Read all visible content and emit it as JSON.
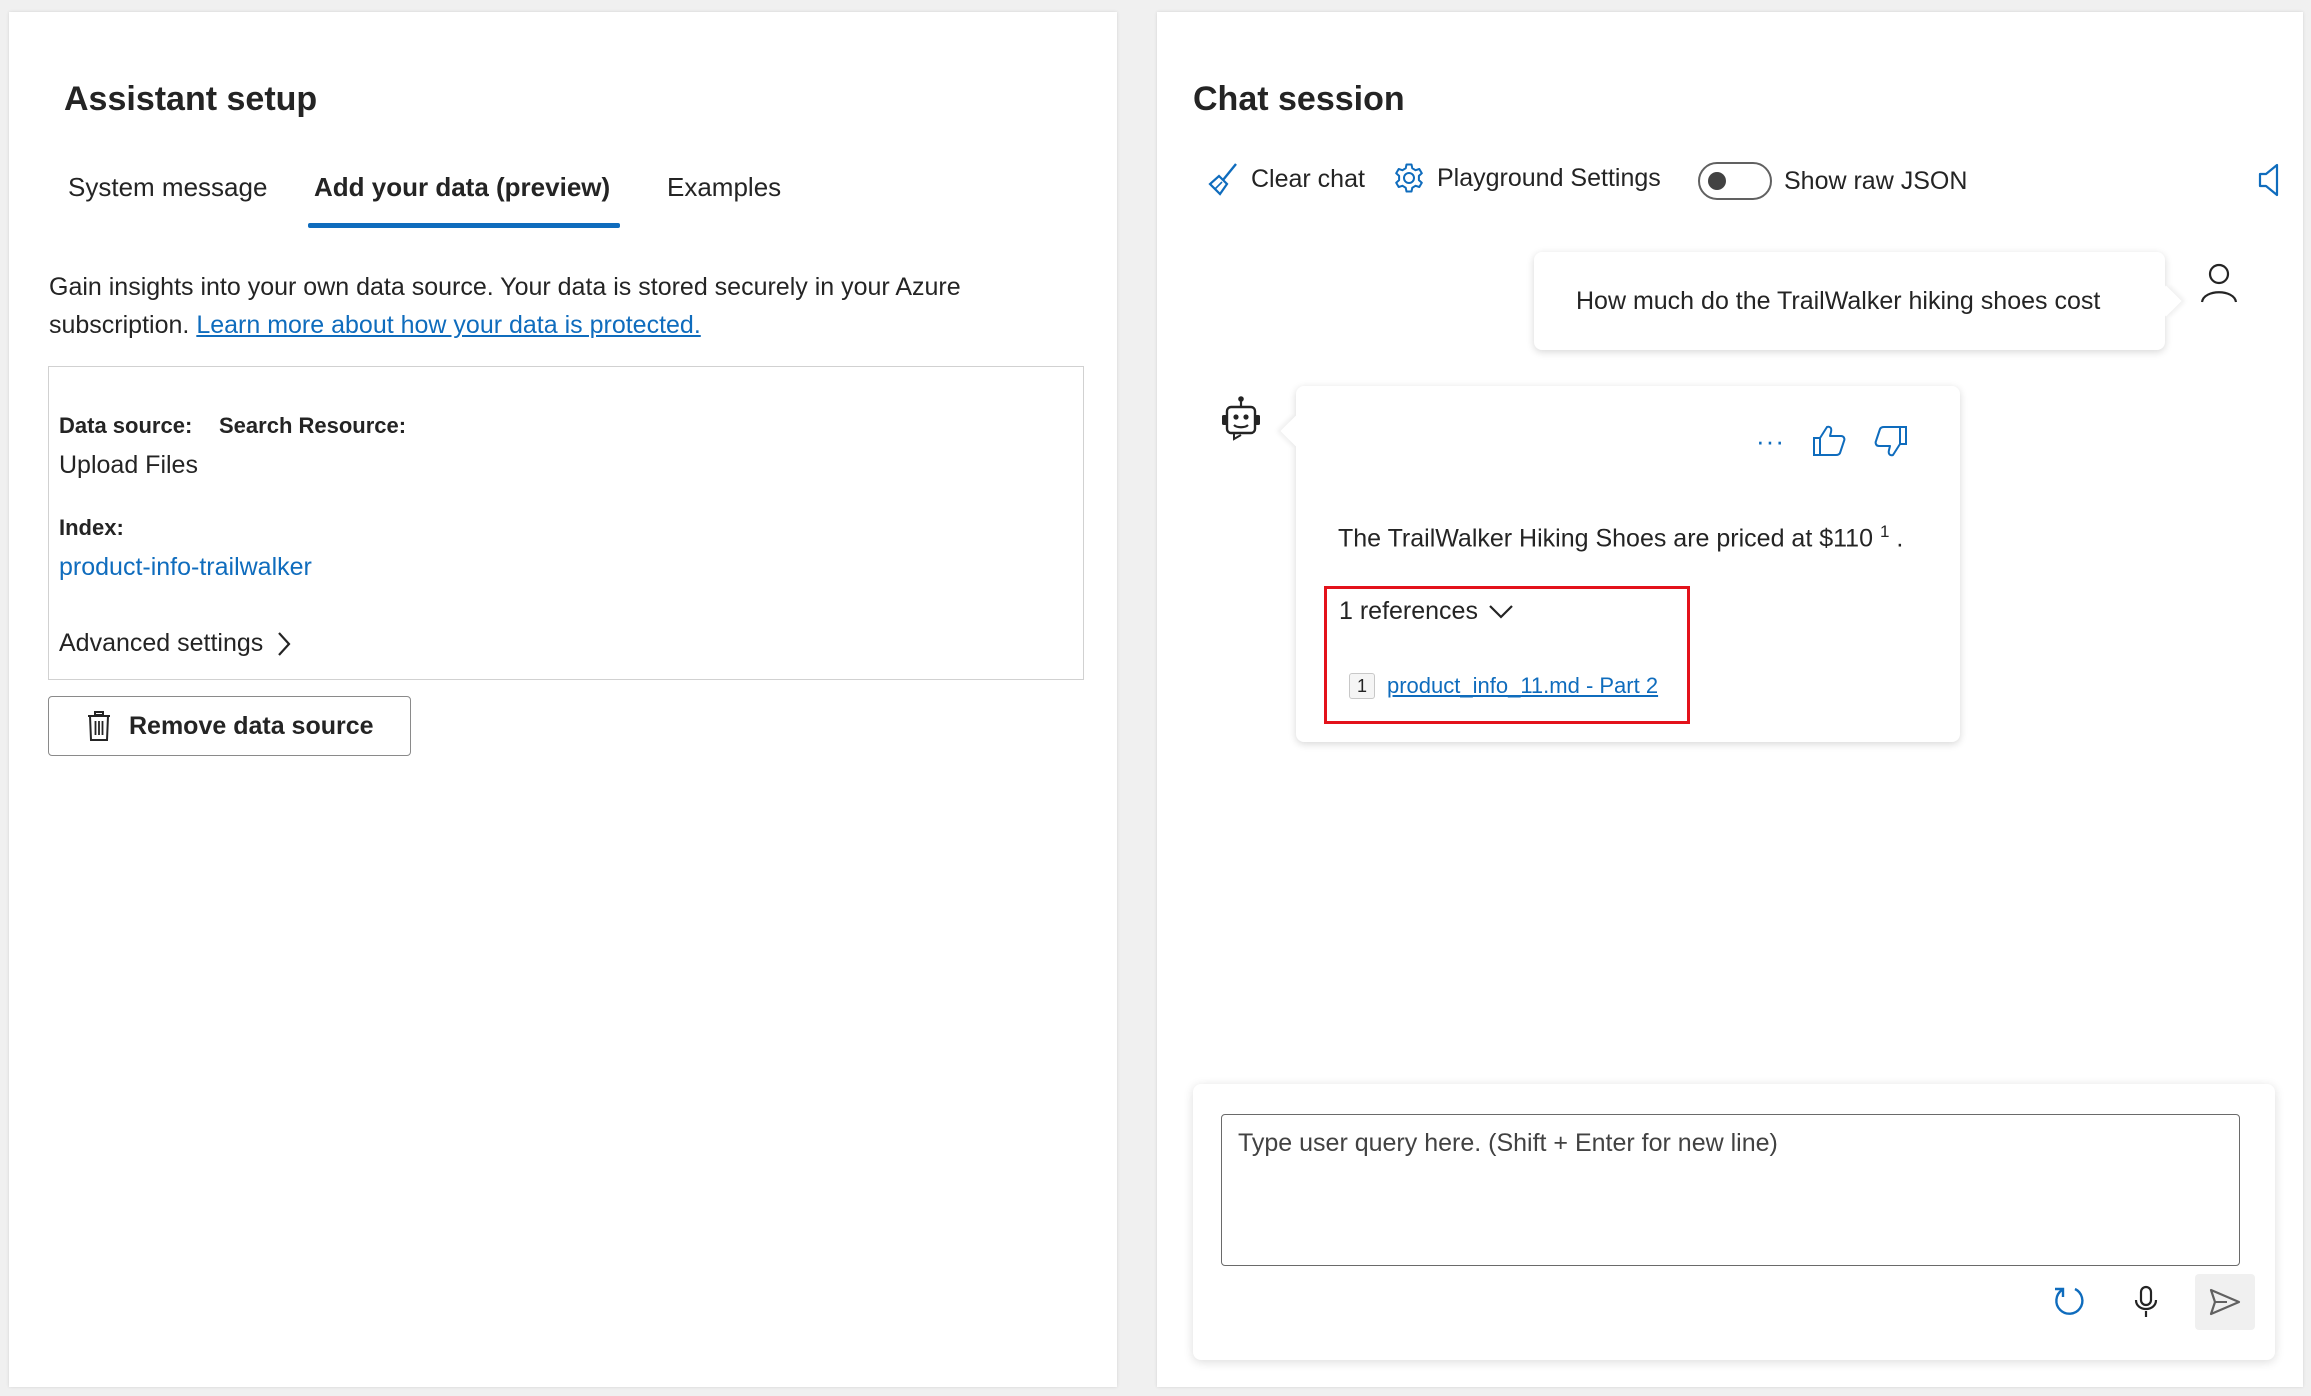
{
  "setup": {
    "title": "Assistant setup",
    "tabs": [
      {
        "label": "System message"
      },
      {
        "label": "Add your data (preview)"
      },
      {
        "label": "Examples"
      }
    ],
    "description": "Gain insights into your own data source. Your data is stored securely in your Azure subscription.",
    "learn_more_link": "Learn more about how your data is protected.",
    "data_source_label": "Data source:",
    "data_source_value": "Upload Files",
    "search_resource_label": "Search Resource:",
    "index_label": "Index:",
    "index_value": "product-info-trailwalker",
    "advanced_settings": "Advanced settings",
    "remove_button": "Remove data source"
  },
  "chat": {
    "title": "Chat session",
    "toolbar": {
      "clear_chat": "Clear chat",
      "playground_settings": "Playground Settings",
      "show_raw_json": "Show raw JSON",
      "show_raw_json_on": false
    },
    "user_message": "How much do the TrailWalker hiking shoes cost",
    "assistant_message": {
      "text": "The TrailWalker Hiking Shoes are priced at $110",
      "citation": "1",
      "trailing": ".",
      "references_label": "1 references",
      "references": [
        {
          "number": "1",
          "label": "product_info_11.md - Part 2"
        }
      ]
    },
    "input_placeholder": "Type user query here. (Shift + Enter for new line)"
  },
  "colors": {
    "accent": "#0f6cbd",
    "highlight_border": "#e3121b"
  }
}
